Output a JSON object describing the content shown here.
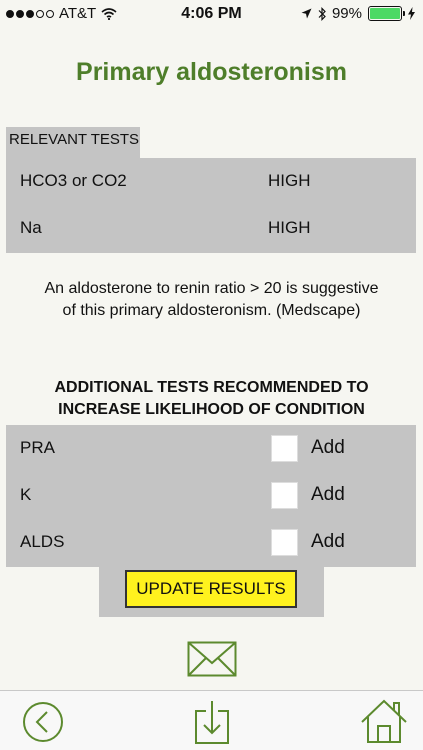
{
  "status_bar": {
    "carrier": "AT&T",
    "time": "4:06 PM",
    "battery": "99%",
    "battery_level": 0.99,
    "icons": [
      "signal-dots-icon",
      "wifi-icon",
      "location-arrow-icon",
      "bluetooth-icon",
      "battery-icon"
    ]
  },
  "page": {
    "title": "Primary aldosteronism"
  },
  "relevant_tests": {
    "heading": "RELEVANT TESTS",
    "rows": [
      {
        "name": "HCO3 or CO2",
        "value": "HIGH"
      },
      {
        "name": "Na",
        "value": "HIGH"
      }
    ]
  },
  "note": {
    "line1": "An aldosterone to renin ratio > 20 is suggestive",
    "line2": "of this primary aldosteronism. (Medscape)"
  },
  "additional_tests": {
    "heading_line1": "ADDITIONAL TESTS RECOMMENDED TO",
    "heading_line2": "INCREASE LIKELIHOOD OF CONDITION",
    "rows": [
      {
        "name": "PRA",
        "add_label": "Add",
        "checked": false
      },
      {
        "name": "K",
        "add_label": "Add",
        "checked": false
      },
      {
        "name": "ALDS",
        "add_label": "Add",
        "checked": false
      }
    ]
  },
  "update_button": {
    "label": "UPDATE RESULTS"
  },
  "toolbar": {
    "icons": [
      "mail-icon",
      "back-icon",
      "download-icon",
      "home-icon"
    ]
  },
  "colors": {
    "accent_green": "#4e7e2a",
    "panel_gray": "#c4c4c4",
    "button_yellow": "#fff21e",
    "background": "#f6f6f1",
    "battery_green": "#4cd964"
  }
}
